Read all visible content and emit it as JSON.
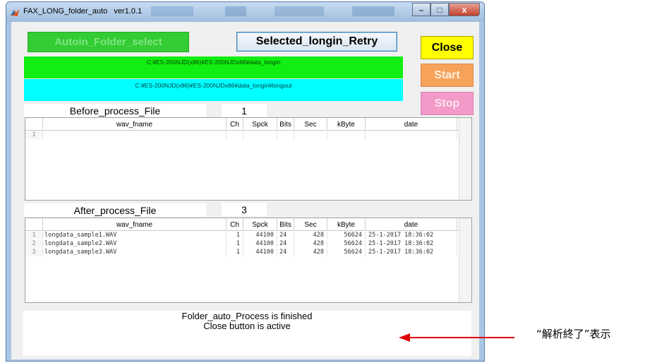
{
  "window": {
    "title": "FAX_LONG_folder_auto   ver1.0.1",
    "min_glyph": "–",
    "max_glyph": "□",
    "close_glyph": "x"
  },
  "buttons": {
    "autoin": "Autoin_Folder_select",
    "retry": "Selected_longin_Retry",
    "close": "Close",
    "start": "Start",
    "stop": "Stop"
  },
  "paths": {
    "input": "C:¥ES-200NJD(x86)¥ES-200NJDx86¥data_longin",
    "output": "C:¥ES-200NJD(x86)¥ES-200NJDx86¥data_longin¥longout"
  },
  "before": {
    "label": "Before_process_File",
    "count": "1",
    "columns": [
      "wav_fname",
      "Ch",
      "Spck",
      "Bits",
      "Sec",
      "kByte",
      "date"
    ],
    "rows": [
      {
        "idx": "1",
        "wav_fname": "",
        "ch": "",
        "spck": "",
        "bits": "",
        "sec": "",
        "kbyte": "",
        "date": ""
      }
    ]
  },
  "after": {
    "label": "After_process_File",
    "count": "3",
    "columns": [
      "wav_fname",
      "Ch",
      "Spck",
      "Bits",
      "Sec",
      "kByte",
      "date"
    ],
    "rows": [
      {
        "idx": "1",
        "wav_fname": "longdata_sample1.WAV",
        "ch": "1",
        "spck": "44100",
        "bits": "24",
        "sec": "428",
        "kbyte": "56624",
        "date": "25-1-2017 18:36:02"
      },
      {
        "idx": "2",
        "wav_fname": "longdata_sample2.WAV",
        "ch": "1",
        "spck": "44100",
        "bits": "24",
        "sec": "428",
        "kbyte": "56624",
        "date": "25-1-2017 18:36:02"
      },
      {
        "idx": "3",
        "wav_fname": "longdata_sample3.WAV",
        "ch": "1",
        "spck": "44100",
        "bits": "24",
        "sec": "428",
        "kbyte": "56624",
        "date": "25-1-2017 18:36:02"
      }
    ]
  },
  "status": {
    "line1": "Folder_auto_Process is finished",
    "line2": "Close button is active"
  },
  "annotation": {
    "text": "“解析終了”表示",
    "arrow_color": "#e00000"
  },
  "colors": {
    "autoin_bg": "#33cc33",
    "path_in_bg": "#11ee11",
    "path_out_bg": "#00ffff",
    "close_bg": "#ffff00",
    "start_bg": "#f7a25a",
    "stop_bg": "#f39ac8"
  }
}
